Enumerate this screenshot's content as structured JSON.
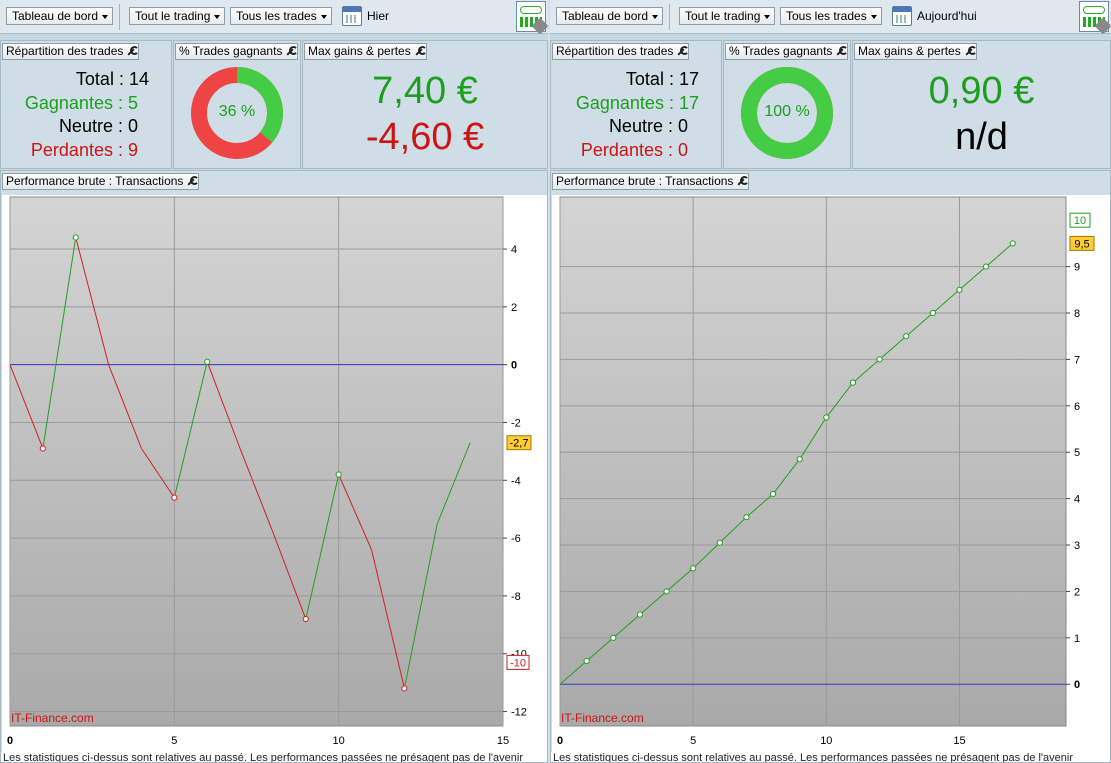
{
  "colors": {
    "green": "#1e9e1e",
    "red": "#cc1414",
    "zero_line": "#3c3ccc",
    "badge": "#ffcc33",
    "donut_green": "#44cc44",
    "donut_red": "#ee4444"
  },
  "panels": [
    {
      "toolbar": {
        "dashboard_label": "Tableau de bord",
        "trading_label": "Tout le trading",
        "trades_label": "Tous les trades",
        "period_label": "Hier"
      },
      "repartition": {
        "header": "Répartition des trades",
        "total_label": "Total",
        "total_value": "14",
        "winning_label": "Gagnantes",
        "winning_value": "5",
        "neutral_label": "Neutre",
        "neutral_value": "0",
        "losing_label": "Perdantes",
        "losing_value": "9"
      },
      "pct": {
        "header": "% Trades gagnants",
        "label": "36 %",
        "value": 36
      },
      "max": {
        "header": "Max gains & pertes",
        "gain": "7,40 €",
        "loss": "-4,60 €"
      },
      "chart_header": "Performance brute : Transactions",
      "watermark": "IT-Finance.com",
      "disclaimer": "Les statistiques ci-dessus sont relatives au passé. Les performances passées ne présagent pas de l'avenir",
      "chart_data": {
        "type": "line",
        "title": "Performance brute : Transactions",
        "xlim": [
          0,
          15
        ],
        "ylim": [
          -12.5,
          5.8
        ],
        "x_ticks": [
          "0",
          "5",
          "10",
          "15"
        ],
        "y_ticks": [
          "4",
          "2",
          "0",
          "-2",
          "-4",
          "-6",
          "-8",
          "-10",
          "-12"
        ],
        "y_tick_values": [
          4,
          2,
          0,
          -2,
          -4,
          -6,
          -8,
          -10,
          -12
        ],
        "x": [
          0,
          1,
          2,
          3,
          4,
          5,
          6,
          7,
          8,
          9,
          10,
          11,
          12,
          13,
          14
        ],
        "y": [
          0,
          -2.9,
          4.4,
          0,
          -2.9,
          -4.6,
          0.1,
          -2.9,
          -5.8,
          -8.8,
          -3.8,
          -6.4,
          -11.2,
          -5.5,
          -2.7
        ],
        "last_value_label": "-2,7",
        "last_value": -2.7,
        "min_marker_label": "-10",
        "min_marker_value": -10.3
      }
    },
    {
      "toolbar": {
        "dashboard_label": "Tableau de bord",
        "trading_label": "Tout le trading",
        "trades_label": "Tous les trades",
        "period_label": "Aujourd'hui"
      },
      "repartition": {
        "header": "Répartition des trades",
        "total_label": "Total",
        "total_value": "17",
        "winning_label": "Gagnantes",
        "winning_value": "17",
        "neutral_label": "Neutre",
        "neutral_value": "0",
        "losing_label": "Perdantes",
        "losing_value": "0"
      },
      "pct": {
        "header": "% Trades gagnants",
        "label": "100 %",
        "value": 100
      },
      "max": {
        "header": "Max gains & pertes",
        "gain": "0,90 €",
        "loss": "n/d"
      },
      "chart_header": "Performance brute : Transactions",
      "watermark": "IT-Finance.com",
      "disclaimer": "Les statistiques ci-dessus sont relatives au passé. Les performances passées ne présagent pas de l'avenir",
      "chart_data": {
        "type": "line",
        "title": "Performance brute : Transactions",
        "xlim": [
          0,
          19
        ],
        "ylim": [
          -0.9,
          10.5
        ],
        "x_ticks": [
          "0",
          "5",
          "10",
          "15"
        ],
        "y_ticks": [
          "9",
          "8",
          "7",
          "6",
          "5",
          "4",
          "3",
          "2",
          "1",
          "0"
        ],
        "y_tick_values": [
          9,
          8,
          7,
          6,
          5,
          4,
          3,
          2,
          1,
          0
        ],
        "x": [
          0,
          1,
          2,
          3,
          4,
          5,
          6,
          7,
          8,
          9,
          10,
          11,
          12,
          13,
          14,
          15,
          16,
          17
        ],
        "y": [
          0,
          0.5,
          1.0,
          1.5,
          2.0,
          2.5,
          3.05,
          3.6,
          4.1,
          4.85,
          5.75,
          6.5,
          7.0,
          7.5,
          8.0,
          8.5,
          9.0,
          9.5
        ],
        "last_value_label": "9,5",
        "last_value": 9.5,
        "max_marker_label": "10",
        "max_marker_value": 10.0
      }
    }
  ]
}
